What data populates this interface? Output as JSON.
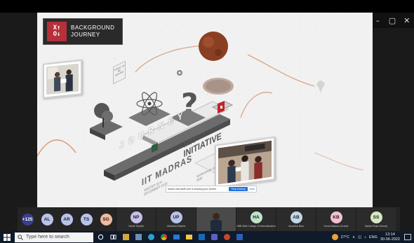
{
  "window": {
    "controls": [
      "–",
      "▢",
      "✕"
    ]
  },
  "slide": {
    "logo_line1": "BACKGROUND",
    "logo_line2": "JOURNEY",
    "stage_words": [
      "JOURNEY",
      "IIT MADRAS",
      "MIT INITIATIVE"
    ],
    "small_labels": [
      "THESE TO BE SOLVED",
      "WORKSHOP JANUARY 2020",
      "WINTER SCH DECEMBER 2019"
    ]
  },
  "share_bar": {
    "message": "teams.microsoft.com is sharing your screen.",
    "stop_label": "Stop sharing",
    "hide_label": "Hide"
  },
  "participants": [
    {
      "initials": "+125",
      "color": "#3a3f8a",
      "name": "",
      "wide": false
    },
    {
      "initials": "AL",
      "color": "#b9c3ea",
      "name": "",
      "wide": false
    },
    {
      "initials": "AR",
      "color": "#b9c3ea",
      "name": "",
      "wide": false
    },
    {
      "initials": "TS",
      "color": "#b9c3ea",
      "name": "",
      "wide": false
    },
    {
      "initials": "SG",
      "color": "#f2b8a0",
      "name": "",
      "wide": false
    },
    {
      "initials": "NP",
      "color": "#c9c0ea",
      "name": "Nehal Tripathi",
      "wide": true
    },
    {
      "initials": "UP",
      "color": "#b9c3ea",
      "name": "Utkarsha Rakshe",
      "wide": true
    },
    {
      "initials": "",
      "color": "",
      "name": "",
      "wide": true,
      "video": true
    },
    {
      "initials": "HA",
      "color": "#bfe3c9",
      "name": "HBB Wdb College Of Administration",
      "wide": true
    },
    {
      "initials": "AB",
      "color": "#c4d6e8",
      "name": "Anushka Bian",
      "wide": true
    },
    {
      "initials": "KB",
      "color": "#f5c1cf",
      "name": "Kunal Balwani (Guest)",
      "wide": true
    },
    {
      "initials": "SS",
      "color": "#d4e8c2",
      "name": "Sakshi Shah (Guest)",
      "wide": true
    }
  ],
  "taskbar": {
    "search_placeholder": "Type here to search",
    "weather": "27°C",
    "lang": "ENG",
    "time": "13:14",
    "date": "30-06-2022"
  }
}
